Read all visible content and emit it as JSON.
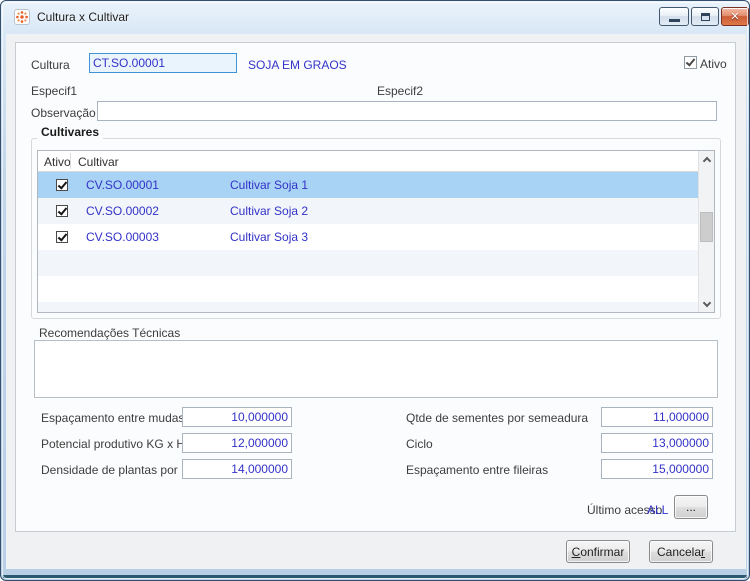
{
  "window": {
    "title": "Cultura x Cultivar"
  },
  "form": {
    "cultura": {
      "label": "Cultura",
      "value": "CT.SO.00001",
      "description": "SOJA EM GRAOS"
    },
    "ativo": {
      "label": "Ativo",
      "checked": true
    },
    "especif1_label": "Especif1",
    "especif2_label": "Especif2",
    "observacao": {
      "label": "Observação",
      "value": ""
    }
  },
  "cultivares": {
    "title": "Cultivares",
    "columns": {
      "ativo": "Ativo",
      "cultivar": "Cultivar"
    },
    "rows": [
      {
        "checked": true,
        "code": "CV.SO.00001",
        "name": "Cultivar Soja 1",
        "selected": true
      },
      {
        "checked": true,
        "code": "CV.SO.00002",
        "name": "Cultivar Soja 2",
        "selected": false
      },
      {
        "checked": true,
        "code": "CV.SO.00003",
        "name": "Cultivar Soja 3",
        "selected": false
      }
    ]
  },
  "recomendacoes": {
    "label": "Recomendações Técnicas",
    "value": ""
  },
  "parameters": {
    "left": [
      {
        "label": "Espaçamento entre mudas",
        "value": "10,000000"
      },
      {
        "label": "Potencial produtivo KG x HA",
        "value": "12,000000"
      },
      {
        "label": "Densidade de plantas por HA",
        "value": "14,000000"
      }
    ],
    "right": [
      {
        "label": "Qtde de sementes por semeadura",
        "value": "11,000000"
      },
      {
        "label": "Ciclo",
        "value": "13,000000"
      },
      {
        "label": "Espaçamento entre fileiras",
        "value": "15,000000"
      }
    ]
  },
  "footer": {
    "ultimo_acesso_label": "Último acesso",
    "ultimo_acesso_value": "ALL",
    "browse_label": "...",
    "confirm_label": "Confirmar",
    "cancel_label": "Cancelar"
  },
  "colors": {
    "data_text": "#3232c8",
    "selected_row": "#a9d3f4",
    "focus_border": "#3f94d8",
    "close_button": "#cd5c37",
    "icon_orange": "#e55f27"
  }
}
